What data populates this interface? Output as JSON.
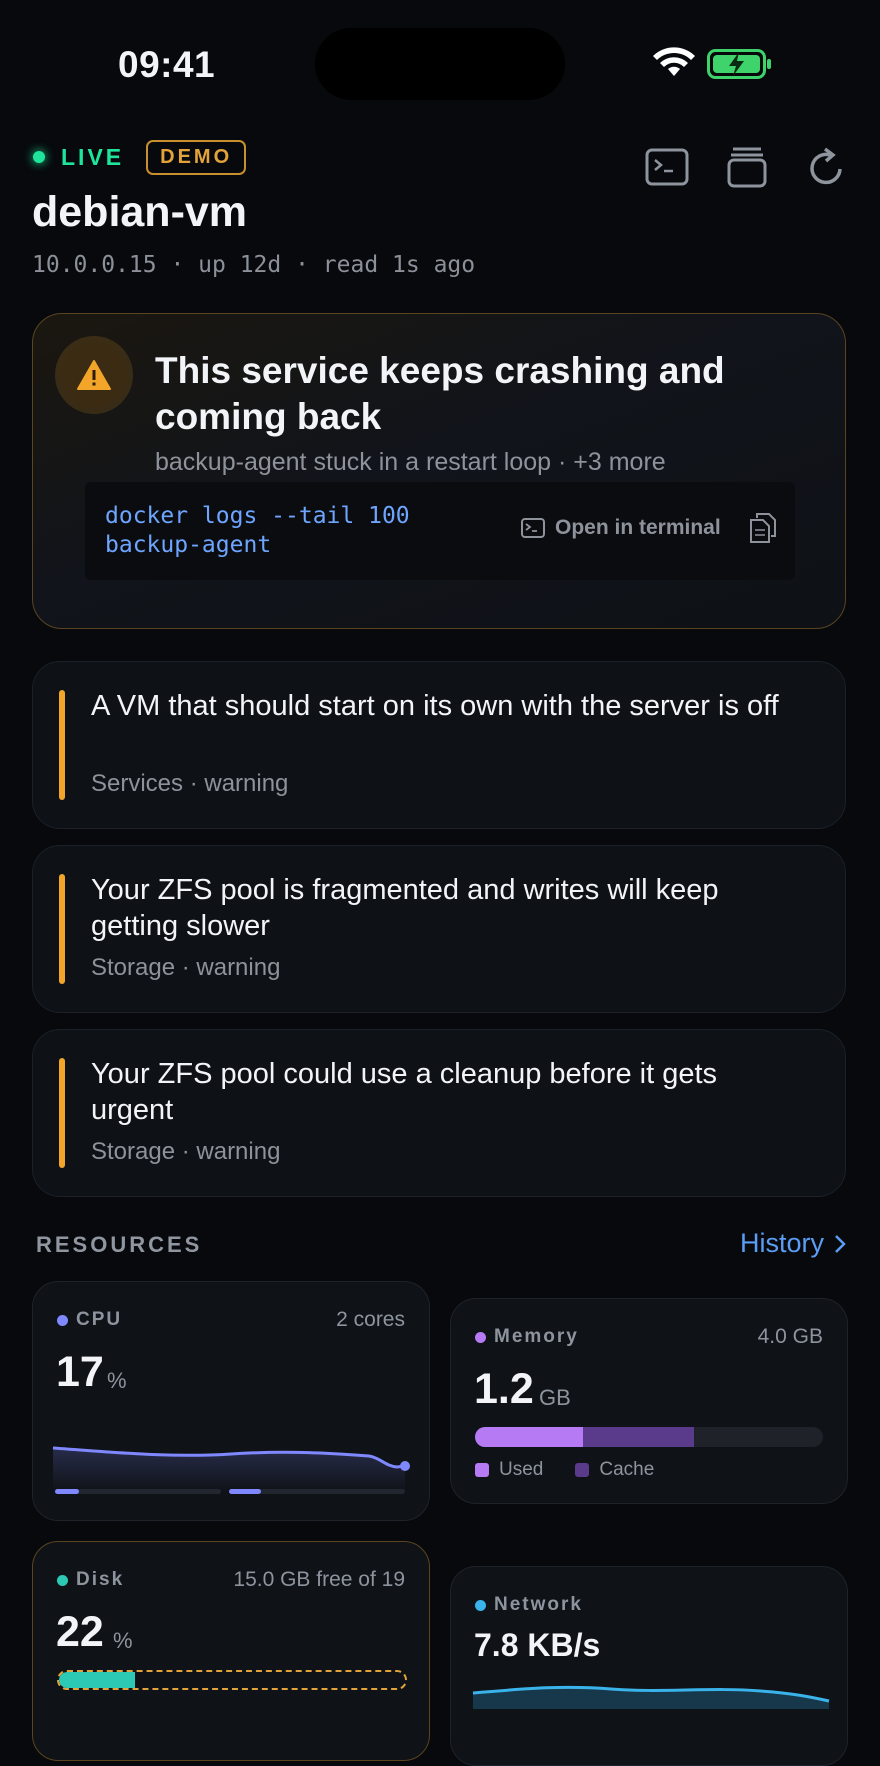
{
  "status_bar": {
    "time": "09:41"
  },
  "header": {
    "live_label": "LIVE",
    "demo_label": "DEMO",
    "host_name": "debian-vm",
    "host_sub": "10.0.0.15 · up 12d · read 1s ago",
    "icons": [
      "terminal-icon",
      "layers-icon",
      "refresh-icon"
    ]
  },
  "critical": {
    "title": "This service keeps crashing and coming back",
    "subtitle": "backup-agent stuck in a restart loop · +3 more",
    "command": "docker logs --tail 100\nbackup-agent",
    "open_terminal_label": "Open in terminal"
  },
  "warnings": [
    {
      "title": "A VM that should start on its own with the server is off",
      "meta": "Services · warning"
    },
    {
      "title": "Your ZFS pool is fragmented and writes will keep getting slower",
      "meta": "Storage · warning"
    },
    {
      "title": "Your ZFS pool could use a cleanup before it gets urgent",
      "meta": "Storage · warning"
    }
  ],
  "resources": {
    "section_label": "RESOURCES",
    "history_label": "History",
    "cpu": {
      "name": "CPU",
      "meta": "2 cores",
      "value": "17",
      "unit": "%",
      "color": "#7f88ff"
    },
    "memory": {
      "name": "Memory",
      "meta": "4.0 GB",
      "value": "1.2",
      "unit": "GB",
      "used_label": "Used",
      "cache_label": "Cache",
      "used_fraction": 0.31,
      "cache_fraction": 0.32,
      "used_color": "#b77af5",
      "cache_color": "#5a3a8a",
      "dot_color": "#b77af5"
    },
    "disk": {
      "name": "Disk",
      "meta": "15.0 GB free of 19",
      "value": "22",
      "unit": "%",
      "fraction": 0.22,
      "color": "#2cc9b4"
    },
    "network": {
      "name": "Network",
      "value": "7.8 KB/s",
      "color": "#39b3ea"
    }
  },
  "colors": {
    "accent_live": "#1ee59a",
    "warning": "#f2a528",
    "link": "#5b9df5"
  }
}
